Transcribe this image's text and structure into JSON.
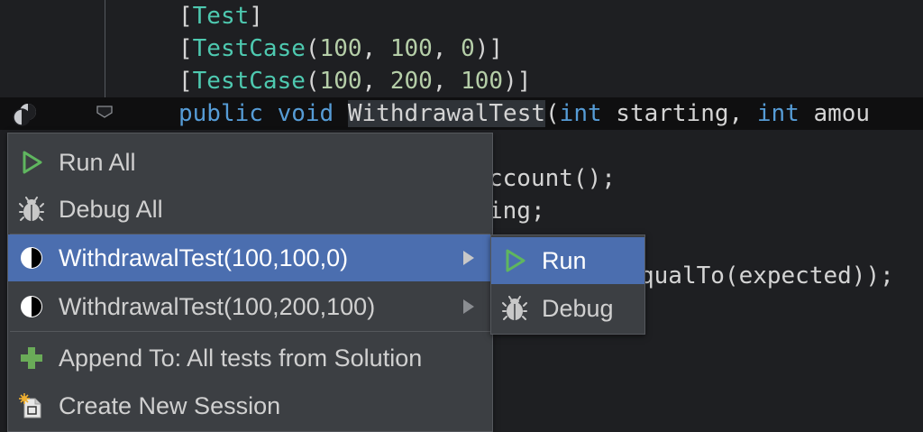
{
  "code": {
    "line1": {
      "open": "[",
      "name": "Test",
      "close": "]"
    },
    "line2": {
      "open": "[",
      "name": "TestCase",
      "args_open": "(",
      "a": "100",
      "c1": ", ",
      "b": "100",
      "c2": ", ",
      "c": "0",
      "close": ")]"
    },
    "line3": {
      "open": "[",
      "name": "TestCase",
      "args_open": "(",
      "a": "100",
      "c1": ", ",
      "b": "200",
      "c2": ", ",
      "c": "100",
      "close": ")]"
    },
    "line4": {
      "kw1": "public",
      "kw2": "void",
      "method": "WithdrawalTest",
      "paren": "(",
      "t1": "int",
      "p1": " starting, ",
      "t2": "int",
      "p2": " amou"
    },
    "line5": "ccount();",
    "line6": "ing;",
    "line7": "qualTo(expected));"
  },
  "menu": {
    "items": [
      {
        "label": "Run All",
        "icon": "run-icon"
      },
      {
        "label": "Debug All",
        "icon": "bug-icon"
      },
      {
        "label": "WithdrawalTest(100,100,0)",
        "icon": "test-status-icon",
        "selected": true,
        "has_submenu": true
      },
      {
        "label": "WithdrawalTest(100,200,100)",
        "icon": "test-status-icon",
        "has_submenu": true
      },
      {
        "label": "Append To: All tests from Solution",
        "icon": "plus-icon"
      },
      {
        "label": "Create New Session",
        "icon": "new-session-icon"
      }
    ]
  },
  "submenu": {
    "items": [
      {
        "label": "Run",
        "icon": "run-icon",
        "selected": true
      },
      {
        "label": "Debug",
        "icon": "bug-icon"
      }
    ]
  },
  "colors": {
    "accent": "#4b6eaf",
    "keyword": "#569cd6",
    "type": "#4ec9b0",
    "number": "#b5cea8",
    "run_green": "#5fb65f",
    "plus_green": "#6aab58"
  }
}
